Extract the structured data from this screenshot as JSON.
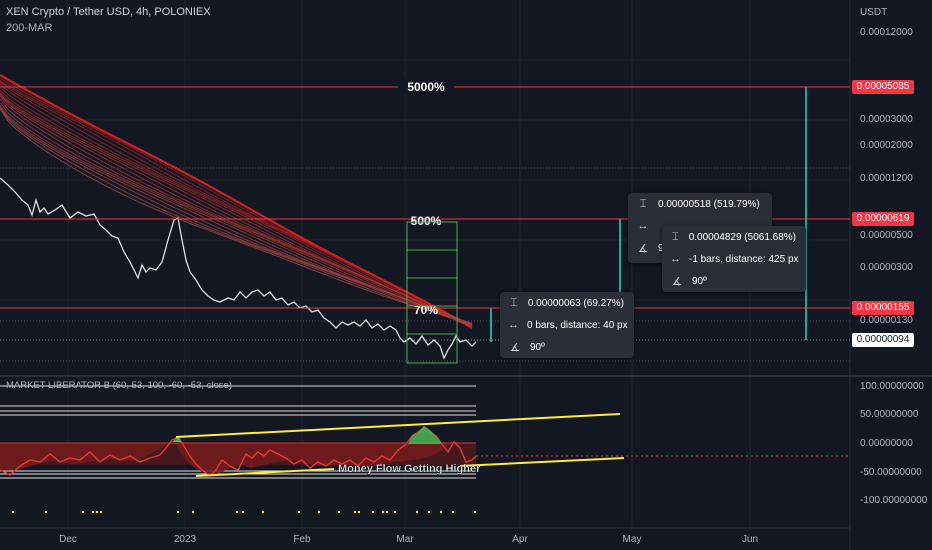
{
  "header": {
    "title": "XEN Crypto / Tether USD, 4h, POLONIEX",
    "indicator": "200-MAR"
  },
  "price_axis": {
    "currency": "USDT",
    "labels": [
      "0.00012000",
      "0.00003000",
      "0.00002000",
      "0.00001200",
      "0.00000500",
      "0.00000300",
      "0.00000130"
    ],
    "tags": [
      {
        "text": "0.00005085",
        "color": "#f23645"
      },
      {
        "text": "0.00000619",
        "color": "#f23645"
      },
      {
        "text": "0.00000155",
        "color": "#f23645"
      },
      {
        "text": "0.00000094",
        "color": "#ffffff"
      }
    ]
  },
  "osc_axis": {
    "labels": [
      "100.00000000",
      "50.00000000",
      "0.00000000",
      "-50.00000000",
      "-100.00000000"
    ]
  },
  "time_axis": {
    "labels": [
      "Dec",
      "2023",
      "Feb",
      "Mar",
      "Apr",
      "May",
      "Jun"
    ]
  },
  "annotations": {
    "pct_5000": "5000%",
    "pct_500": "500%",
    "pct_70": "70%",
    "osc_name": "MARKET LIBERATOR B (60, 53, 100, -60, -53, close)",
    "money_flow": "Money Flow Getting Higher"
  },
  "tooltips": {
    "tip1": {
      "price": "0.00000063 (69.27%)",
      "bars": "0 bars, distance: 40 px",
      "angle": "90º"
    },
    "tip2": {
      "price": "0.00000518 (519.79%)",
      "bars": "",
      "angle": "90º"
    },
    "tip3": {
      "price": "0.00004829 (5061.68%)",
      "bars": "-1 bars, distance: 425 px",
      "angle": "90º"
    }
  },
  "colors": {
    "background": "#131722",
    "ribbon": "#c62828",
    "price_line": "#e6e6e6",
    "measure": "#26a69a",
    "box": "#4caf50",
    "level": "#f23645",
    "trendline": "#ffeb3b"
  }
}
